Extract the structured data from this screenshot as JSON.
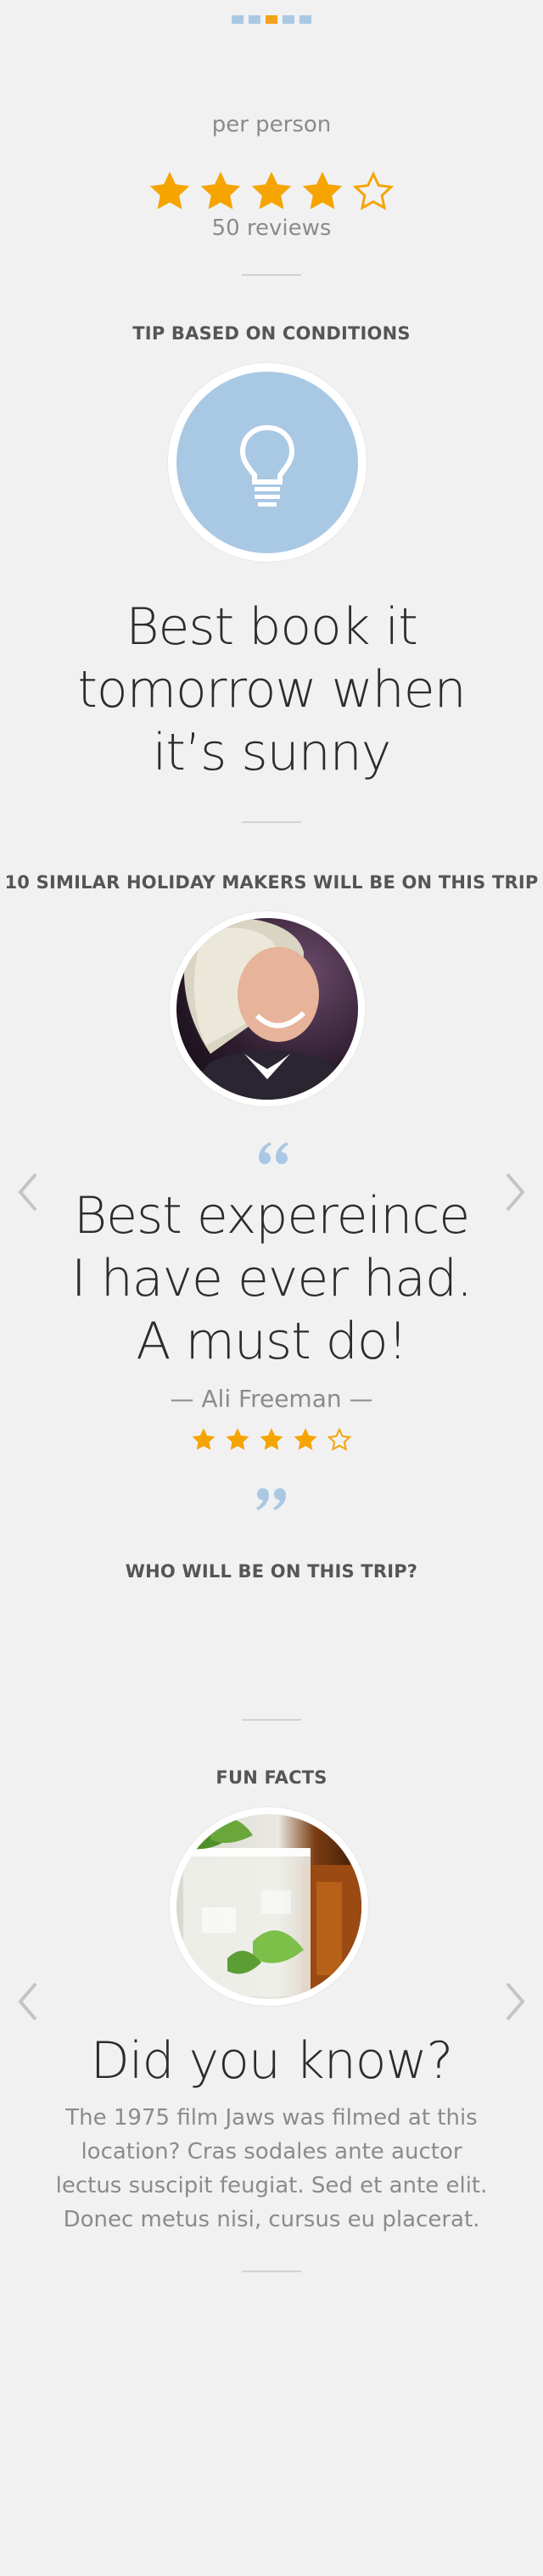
{
  "pagination": {
    "count": 5,
    "active_index": 2
  },
  "price": {
    "per_person_label": "per person"
  },
  "rating": {
    "value": 4,
    "max": 5,
    "reviews_label": "50 reviews"
  },
  "tip": {
    "heading": "TIP BASED ON CONDITIONS",
    "icon": "lightbulb-icon",
    "line1": "Best book it",
    "line2": "tomorrow when",
    "line3": "it’s sunny"
  },
  "similar": {
    "heading": "10 SIMILAR HOLIDAY MAKERS WILL BE ON THIS TRIP",
    "quote_line1": "Best expereince",
    "quote_line2": "I have ever had.",
    "quote_line3": "A must do!",
    "author": "— Ali Freeman —",
    "rating": {
      "value": 4,
      "max": 5
    }
  },
  "who": {
    "heading": "WHO WILL BE ON THIS TRIP?"
  },
  "fun_facts": {
    "heading": "FUN FACTS",
    "title": "Did you know?",
    "body_line1": "The 1975 film Jaws was filmed at this",
    "body_line2": "location? Cras sodales ante auctor",
    "body_line3": "lectus suscipit feugiat. Sed et ante elit.",
    "body_line4": "Donec metus nisi, cursus eu placerat."
  },
  "colors": {
    "accent_blue": "#a9c8e4",
    "star_orange": "#f5a400",
    "background": "#f1f1f1"
  }
}
